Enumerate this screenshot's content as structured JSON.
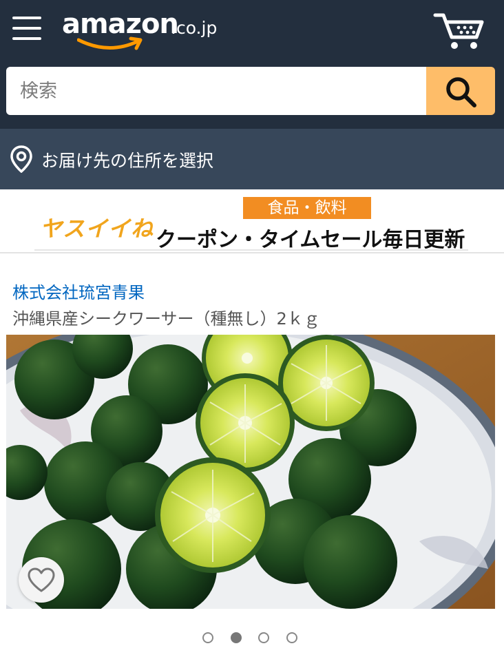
{
  "header": {
    "logo_text": "amazon",
    "logo_suffix": ".co.jp",
    "menu_icon": "hamburger-menu-icon",
    "cart_icon": "cart-icon"
  },
  "search": {
    "placeholder": "検索",
    "button_icon": "search-icon"
  },
  "delivery": {
    "icon": "location-pin-icon",
    "label": "お届け先の住所を選択"
  },
  "banner": {
    "logo_text": "ヤスイイね",
    "category_tag": "食品・飲料",
    "headline": "クーポン・タイムセール毎日更新"
  },
  "product": {
    "brand": "株式会社琉宮青果",
    "title": "沖縄県産シークワーサー（種無し）2ｋｇ",
    "image_count": 4,
    "active_image_index": 1,
    "wishlist_icon": "heart-icon"
  },
  "colors": {
    "header_bg": "#232f3e",
    "delivery_bg": "#37475a",
    "search_button": "#febd69",
    "link_blue": "#0066c0",
    "tag_orange": "#f28d22"
  }
}
